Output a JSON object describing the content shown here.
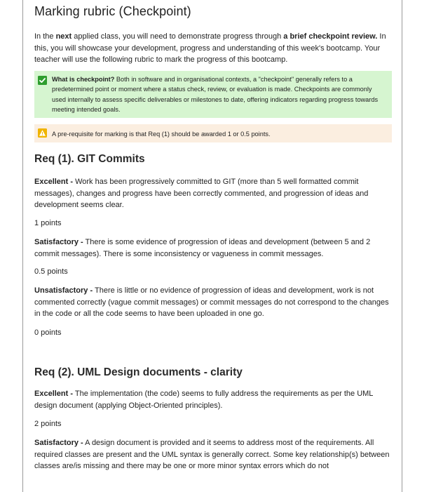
{
  "title": "Marking rubric (Checkpoint)",
  "intro": {
    "t1": "In the ",
    "b1": "next",
    "t2": " applied class, you will need to demonstrate progress through ",
    "b2": "a brief checkpoint review.",
    "t3": "  In this, you will showcase your development, progress and understanding of this week's bootcamp. Your teacher will use the following rubric to mark the progress of this bootcamp."
  },
  "callout_success": {
    "icon": "check-icon",
    "color": "#2e9e2e",
    "bold": "What is checkpoint?",
    "text": " Both in software and in organisational contexts, a \"checkpoint\" generally refers to a predetermined point or moment where a status check, review, or evaluation is made. Checkpoints are commonly used internally to assess specific deliverables or milestones to date, offering indicators regarding progress towards meeting intended goals."
  },
  "callout_warning": {
    "icon": "warning-icon",
    "color": "#f0b400",
    "text": "A pre-requisite for marking is that Req (1) should be awarded 1 or 0.5 points."
  },
  "req1": {
    "heading": "Req (1). GIT Commits",
    "excellent_label": "Excellent -",
    "excellent_text": " Work has been progressively committed to GIT (more than 5 well formatted commit messages), changes and progress have been correctly commented, and progression of ideas and development seems clear.",
    "excellent_points": "1 points",
    "satisfactory_label": "Satisfactory -",
    "satisfactory_text": " There is some evidence of progression of ideas and development (between 5 and 2 commit messages). There is some inconsistency or vagueness in commit messages.",
    "satisfactory_points": "0.5 points",
    "unsatisfactory_label": "Unsatisfactory -",
    "unsatisfactory_text": " There is little or no evidence of progression of ideas and development, work is not commented correctly (vague commit messages) or commit messages do not correspond to the changes in the code or all the code seems to have been uploaded in one go.",
    "unsatisfactory_points": "0 points"
  },
  "req2": {
    "heading": "Req (2). UML Design documents - clarity",
    "excellent_label": "Excellent -",
    "excellent_text": " The implementation (the code) seems to fully address the requirements as per the UML design document (applying Object-Oriented principles).",
    "excellent_points": "2 points",
    "satisfactory_label": "Satisfactory -",
    "satisfactory_text": " A design document is provided and it seems to address most of the requirements. All required classes are present and the UML syntax is generally correct. Some key relationship(s) between classes are/is missing and there may be one or more minor syntax errors which do not"
  }
}
